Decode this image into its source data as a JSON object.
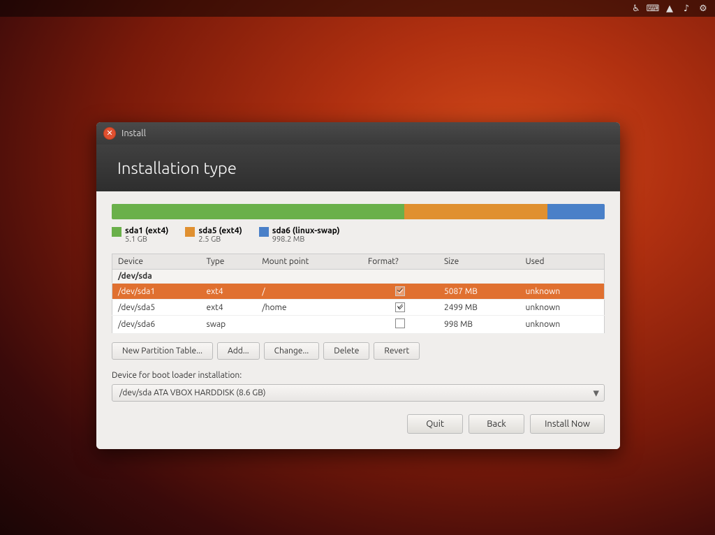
{
  "taskbar": {
    "icons": [
      "accessibility-icon",
      "keyboard-icon",
      "network-icon",
      "volume-icon",
      "settings-icon"
    ]
  },
  "dialog": {
    "title": "Install",
    "header": "Installation type",
    "partition_bar": {
      "segments": [
        {
          "name": "sda1",
          "color": "#6ab04a",
          "flex": 51
        },
        {
          "name": "sda5",
          "color": "#e09030",
          "flex": 25
        },
        {
          "name": "sda6",
          "color": "#4a80c8",
          "flex": 10
        }
      ]
    },
    "legend": [
      {
        "color": "#6ab04a",
        "name": "sda1 (ext4)",
        "size": "5.1 GB"
      },
      {
        "color": "#e09030",
        "name": "sda5 (ext4)",
        "size": "2.5 GB"
      },
      {
        "color": "#4a80c8",
        "name": "sda6 (linux-swap)",
        "size": "998.2 MB"
      }
    ],
    "table": {
      "columns": [
        "Device",
        "Type",
        "Mount point",
        "Format?",
        "Size",
        "Used"
      ],
      "group_row": "/dev/sda",
      "rows": [
        {
          "device": "/dev/sda1",
          "type": "ext4",
          "mount": "/",
          "format": true,
          "size": "5087 MB",
          "used": "unknown",
          "selected": true
        },
        {
          "device": "/dev/sda5",
          "type": "ext4",
          "mount": "/home",
          "format": true,
          "size": "2499 MB",
          "used": "unknown",
          "selected": false
        },
        {
          "device": "/dev/sda6",
          "type": "swap",
          "mount": "",
          "format": false,
          "size": "998 MB",
          "used": "unknown",
          "selected": false
        }
      ]
    },
    "action_buttons": [
      {
        "label": "New Partition Table...",
        "name": "new-partition-table-button"
      },
      {
        "label": "Add...",
        "name": "add-button"
      },
      {
        "label": "Change...",
        "name": "change-button"
      },
      {
        "label": "Delete",
        "name": "delete-button"
      },
      {
        "label": "Revert",
        "name": "revert-button"
      }
    ],
    "bootloader_label": "Device for boot loader installation:",
    "bootloader_value": "/dev/sda   ATA VBOX HARDDISK (8.6 GB)",
    "bottom_buttons": [
      {
        "label": "Quit",
        "name": "quit-button"
      },
      {
        "label": "Back",
        "name": "back-button"
      },
      {
        "label": "Install Now",
        "name": "install-now-button"
      }
    ]
  }
}
